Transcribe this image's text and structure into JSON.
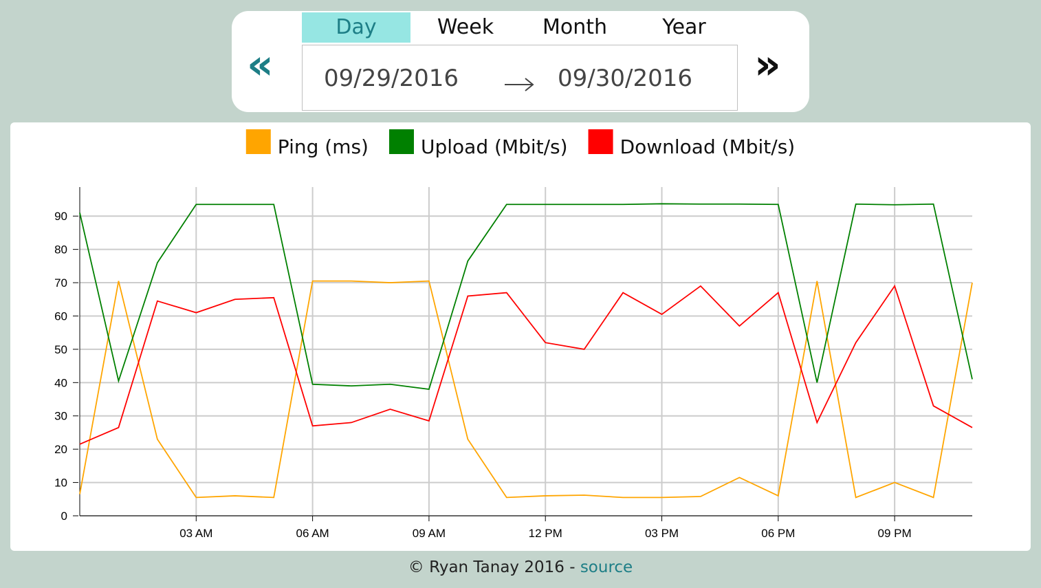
{
  "range_picker": {
    "tabs": [
      {
        "label": "Day",
        "active": true
      },
      {
        "label": "Week",
        "active": false
      },
      {
        "label": "Month",
        "active": false
      },
      {
        "label": "Year",
        "active": false
      }
    ],
    "prev_icon": "double-chevron-left-icon",
    "next_icon": "double-chevron-right-icon",
    "prev_symbol": "«",
    "next_symbol": "»",
    "start_date": "09/29/2016",
    "end_date": "09/30/2016",
    "arrow_icon": "arrow-right-icon"
  },
  "colors": {
    "page_bg": "#c3d4cc",
    "active_tab_bg": "#96e6e3",
    "accent": "#1d7e86",
    "ping": "#ffa500",
    "upload": "#008000",
    "download": "#ff0000"
  },
  "chart_data": {
    "type": "line",
    "xlabel": "",
    "ylabel": "",
    "ylim": [
      0,
      95
    ],
    "yticks": [
      0,
      10,
      20,
      30,
      40,
      50,
      60,
      70,
      80,
      90
    ],
    "x_tick_labels": [
      "03 AM",
      "06 AM",
      "09 AM",
      "12 PM",
      "03 PM",
      "06 PM",
      "09 PM"
    ],
    "x_tick_hours": [
      3,
      6,
      9,
      12,
      15,
      18,
      21
    ],
    "x_range_hours": [
      0,
      23
    ],
    "grid": true,
    "legend": "top-center",
    "x_hours": [
      0,
      1,
      2,
      3,
      4,
      5,
      6,
      7,
      8,
      9,
      10,
      11,
      12,
      13,
      14,
      15,
      16,
      17,
      18,
      19,
      20,
      21,
      22,
      23
    ],
    "series": [
      {
        "name": "Ping (ms)",
        "color": "#ffa500",
        "values": [
          6.5,
          70.5,
          23,
          5.5,
          6,
          5.5,
          70.5,
          70.5,
          70,
          70.5,
          23,
          5.5,
          6,
          6.2,
          5.5,
          5.5,
          5.8,
          11.5,
          6,
          70.5,
          5.5,
          10,
          5.5,
          70
        ]
      },
      {
        "name": "Upload (Mbit/s)",
        "color": "#008000",
        "values": [
          91,
          40.5,
          76,
          93.5,
          93.5,
          93.5,
          39.5,
          39,
          39.5,
          38,
          76.5,
          93.5,
          93.5,
          93.5,
          93.5,
          93.7,
          93.6,
          93.6,
          93.5,
          40,
          93.6,
          93.4,
          93.6,
          41
        ]
      },
      {
        "name": "Download (Mbit/s)",
        "color": "#ff0000",
        "values": [
          21.5,
          26.5,
          64.5,
          61,
          65,
          65.5,
          27,
          28,
          32,
          28.5,
          66,
          67,
          52,
          50,
          67,
          60.5,
          69,
          57,
          67,
          28,
          52,
          69,
          33,
          26.5
        ]
      }
    ]
  },
  "footer": {
    "copyright": "© Ryan Tanay 2016 - ",
    "link": "source"
  }
}
